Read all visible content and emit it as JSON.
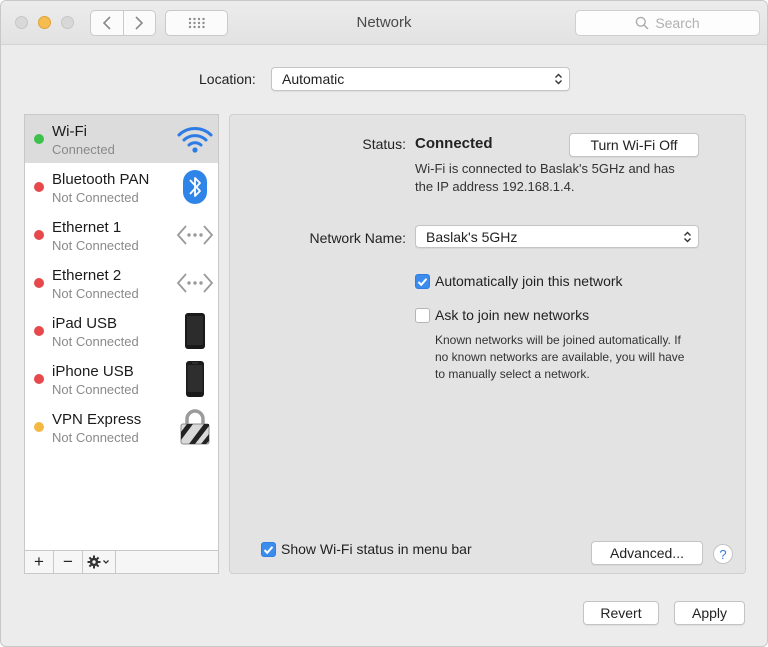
{
  "window": {
    "title": "Network"
  },
  "search": {
    "placeholder": "Search"
  },
  "location": {
    "label": "Location:",
    "value": "Automatic"
  },
  "services": [
    {
      "name": "Wi-Fi",
      "status": "Connected",
      "dot_color": "#3cc24a",
      "icon": "wifi-icon"
    },
    {
      "name": "Bluetooth PAN",
      "status": "Not Connected",
      "dot_color": "#e6484b",
      "icon": "bluetooth-icon"
    },
    {
      "name": "Ethernet 1",
      "status": "Not Connected",
      "dot_color": "#e6484b",
      "icon": "ethernet-icon"
    },
    {
      "name": "Ethernet 2",
      "status": "Not Connected",
      "dot_color": "#e6484b",
      "icon": "ethernet-icon"
    },
    {
      "name": "iPad USB",
      "status": "Not Connected",
      "dot_color": "#e6484b",
      "icon": "ipad-icon"
    },
    {
      "name": "iPhone USB",
      "status": "Not Connected",
      "dot_color": "#e6484b",
      "icon": "iphone-icon"
    },
    {
      "name": "VPN Express",
      "status": "Not Connected",
      "dot_color": "#f4b942",
      "icon": "vpn-lock-icon"
    }
  ],
  "sidebar_controls": {
    "add": "+",
    "remove": "−"
  },
  "detail": {
    "status_label": "Status:",
    "status_value": "Connected",
    "turn_off_button": "Turn Wi-Fi Off",
    "status_desc_line1": "Wi-Fi is connected to Baslak's 5GHz and has",
    "status_desc_line2": "the IP address 192.168.1.4.",
    "network_name_label": "Network Name:",
    "network_name_value": "Baslak's 5GHz",
    "auto_join_label": "Automatically join this network",
    "auto_join_checked": true,
    "ask_join_label": "Ask to join new networks",
    "ask_join_checked": false,
    "ask_join_desc_line1": "Known networks will be joined automatically. If",
    "ask_join_desc_line2": "no known networks are available, you will have",
    "ask_join_desc_line3": "to manually select a network.",
    "show_status_label": "Show Wi-Fi status in menu bar",
    "show_status_checked": true,
    "advanced_button": "Advanced...",
    "help_button": "?"
  },
  "footer": {
    "revert_button": "Revert",
    "apply_button": "Apply"
  },
  "colors": {
    "accent": "#3b8ced",
    "wifi_blue": "#2d7be5",
    "bluetooth_blue": "#2f84e8"
  }
}
